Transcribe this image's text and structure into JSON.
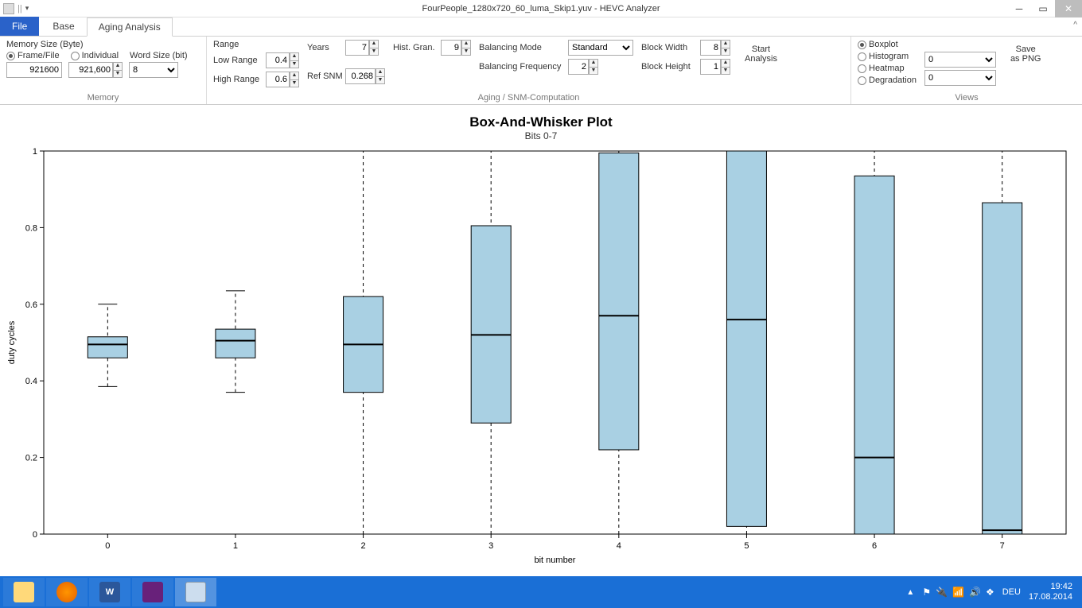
{
  "titlebar": {
    "title": "FourPeople_1280x720_60_luma_Skip1.yuv - HEVC Analyzer"
  },
  "tabs": {
    "file": "File",
    "base": "Base",
    "aging": "Aging Analysis"
  },
  "memory_group": {
    "title": "Memory",
    "header": "Memory Size (Byte)",
    "frame_file": "Frame/File",
    "individual": "Individual",
    "word_size_label": "Word Size (bit)",
    "frame_value": "921600",
    "spin_value": "921,600",
    "word_size_value": "8"
  },
  "range": {
    "label": "Range",
    "low_label": "Low Range",
    "low": "0.4",
    "high_label": "High Range",
    "high": "0.6"
  },
  "years": {
    "label": "Years",
    "value": "7"
  },
  "refsnm": {
    "label": "Ref SNM",
    "value": "0.268"
  },
  "histgran": {
    "label": "Hist. Gran.",
    "value": "9"
  },
  "balancing": {
    "mode_label": "Balancing Mode",
    "mode_value": "Standard",
    "freq_label": "Balancing Frequency",
    "freq_value": "2"
  },
  "block": {
    "w_label": "Block Width",
    "w": "8",
    "h_label": "Block Height",
    "h": "1"
  },
  "aging_group_title": "Aging / SNM-Computation",
  "start": {
    "line1": "Start",
    "line2": "Analysis"
  },
  "views": {
    "title": "Views",
    "boxplot": "Boxplot",
    "histogram": "Histogram",
    "heatmap": "Heatmap",
    "degradation": "Degradation",
    "hist_dd": "0",
    "heat_dd": "0",
    "save1": "Save",
    "save2": "as PNG"
  },
  "chart": {
    "title": "Box-And-Whisker Plot",
    "subtitle": "Bits 0-7",
    "xlabel": "bit number",
    "ylabel": "duty cycles"
  },
  "chart_data": {
    "type": "boxplot",
    "title": "Box-And-Whisker Plot",
    "subtitle": "Bits 0-7",
    "xlabel": "bit number",
    "ylabel": "duty cycles",
    "ylim": [
      0,
      1
    ],
    "yticks": [
      0,
      0.2,
      0.4,
      0.6,
      0.8,
      1
    ],
    "categories": [
      0,
      1,
      2,
      3,
      4,
      5,
      6,
      7
    ],
    "series": [
      {
        "bit": 0,
        "low": 0.385,
        "q1": 0.46,
        "median": 0.495,
        "q3": 0.515,
        "high": 0.6
      },
      {
        "bit": 1,
        "low": 0.37,
        "q1": 0.46,
        "median": 0.505,
        "q3": 0.535,
        "high": 0.635
      },
      {
        "bit": 2,
        "low": 0.0,
        "q1": 0.37,
        "median": 0.495,
        "q3": 0.62,
        "high": 1.0
      },
      {
        "bit": 3,
        "low": 0.0,
        "q1": 0.29,
        "median": 0.52,
        "q3": 0.805,
        "high": 1.0
      },
      {
        "bit": 4,
        "low": 0.0,
        "q1": 0.22,
        "median": 0.57,
        "q3": 0.995,
        "high": 1.0
      },
      {
        "bit": 5,
        "low": 0.0,
        "q1": 0.02,
        "median": 0.56,
        "q3": 1.0,
        "high": 1.0
      },
      {
        "bit": 6,
        "low": 0.0,
        "q1": 0.0,
        "median": 0.2,
        "q3": 0.935,
        "high": 1.0
      },
      {
        "bit": 7,
        "low": 0.0,
        "q1": 0.0,
        "median": 0.01,
        "q3": 0.865,
        "high": 1.0
      }
    ]
  },
  "taskbar": {
    "lang": "DEU",
    "time": "19:42",
    "date": "17.08.2014"
  }
}
